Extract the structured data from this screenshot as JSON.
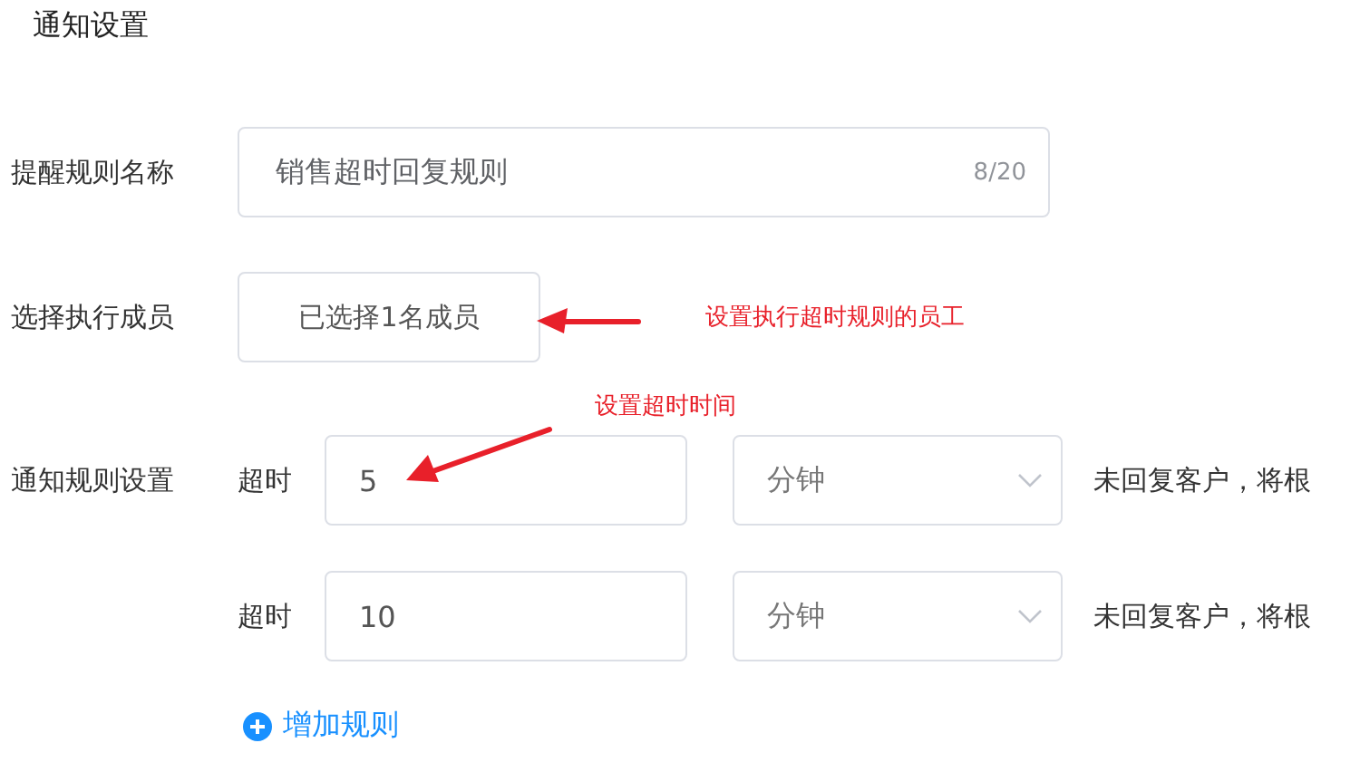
{
  "title": "通知设置",
  "name_field": {
    "label": "提醒规则名称",
    "value": "销售超时回复规则",
    "count": "8/20"
  },
  "members": {
    "label": "选择执行成员",
    "button": "已选择1名成员"
  },
  "rules": {
    "label": "通知规则设置",
    "items": [
      {
        "prefix": "超时",
        "value": "5",
        "unit": "分钟",
        "suffix": "未回复客户，将根"
      },
      {
        "prefix": "超时",
        "value": "10",
        "unit": "分钟",
        "suffix": "未回复客户，将根"
      }
    ],
    "add": "增加规则"
  },
  "annotations": [
    {
      "text": "设置执行超时规则的员工"
    },
    {
      "text": "设置超时时间"
    }
  ]
}
